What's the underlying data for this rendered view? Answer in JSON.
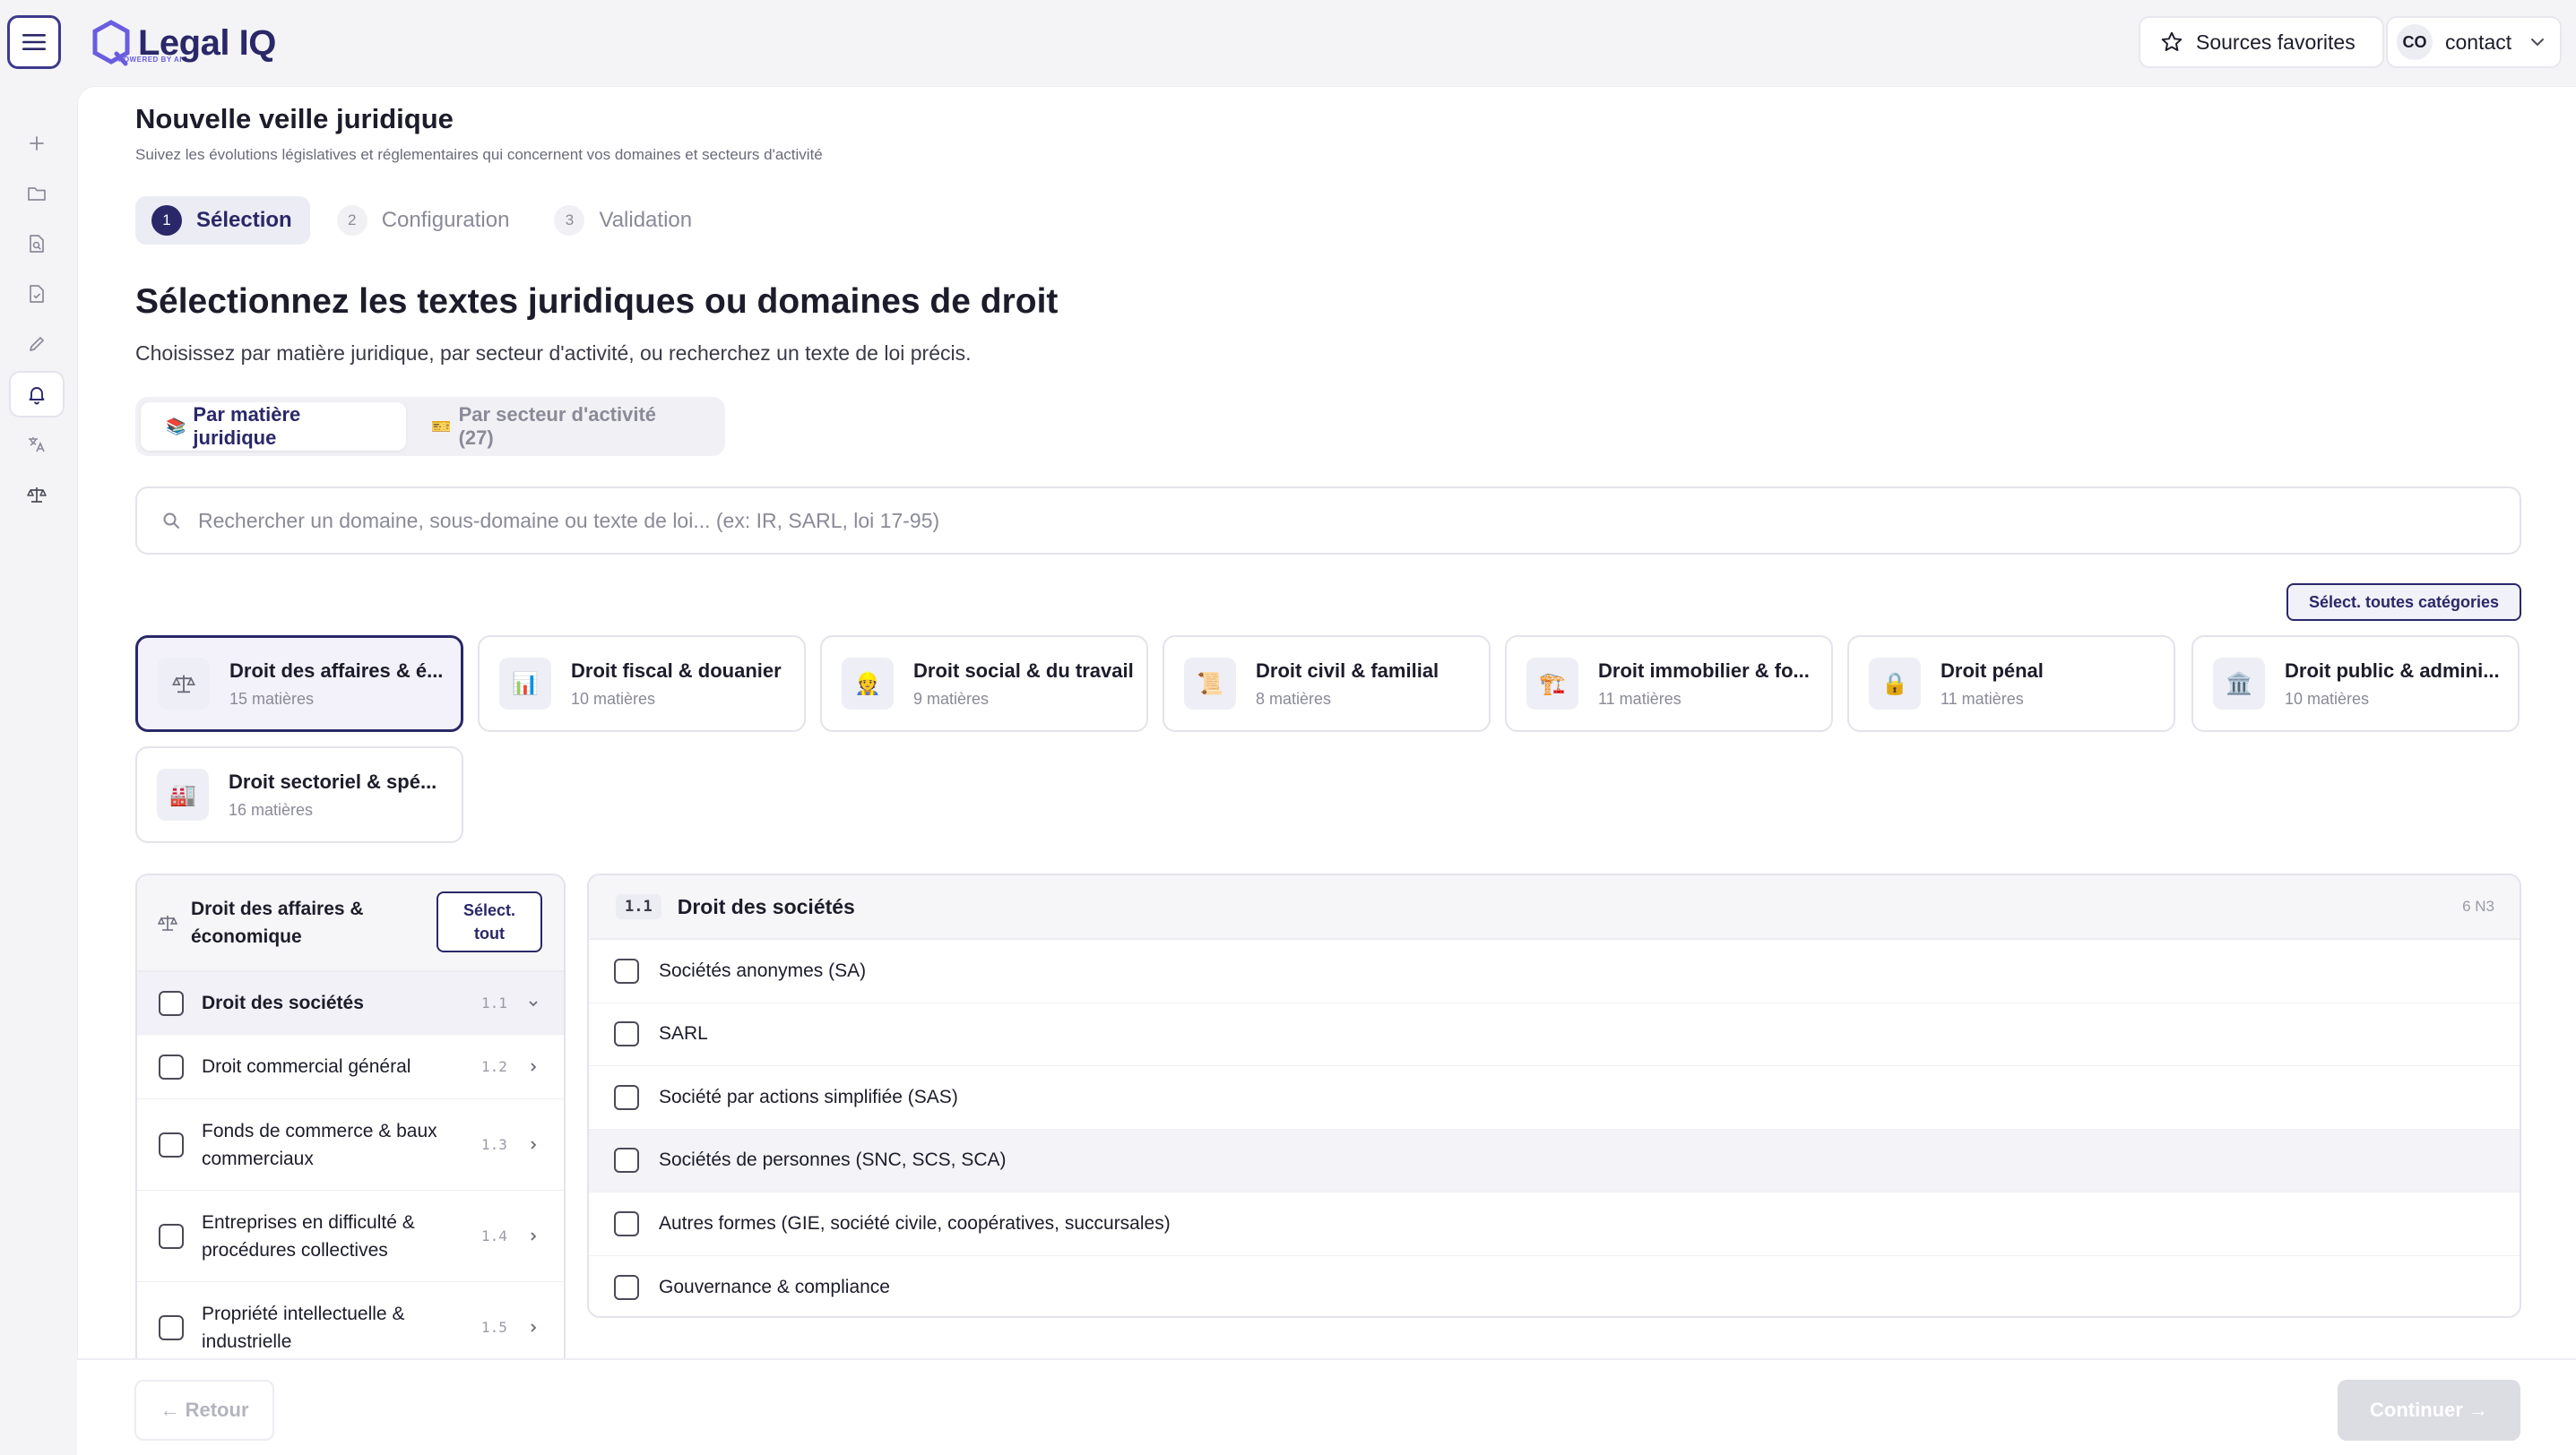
{
  "app": {
    "logo_text": "Legal IQ",
    "logo_sub": "POWERED BY AI",
    "favorites_label": "Sources favorites",
    "user_initials": "CO",
    "user_name": "contact"
  },
  "sidebar": {
    "items": [
      {
        "icon": "plus-icon"
      },
      {
        "icon": "folder-icon"
      },
      {
        "icon": "file-search-icon"
      },
      {
        "icon": "file-check-icon"
      },
      {
        "icon": "pen-icon"
      },
      {
        "icon": "bell-icon",
        "active": true
      },
      {
        "icon": "translate-icon"
      },
      {
        "icon": "scale-icon"
      }
    ]
  },
  "header": {
    "title": "Nouvelle veille juridique",
    "subtitle": "Suivez les évolutions législatives et réglementaires qui concernent vos domaines et secteurs d'activité"
  },
  "steps": [
    {
      "num": "1",
      "label": "Sélection",
      "active": true
    },
    {
      "num": "2",
      "label": "Configuration"
    },
    {
      "num": "3",
      "label": "Validation"
    }
  ],
  "section": {
    "title": "Sélectionnez les textes juridiques ou domaines de droit",
    "subtitle": "Choisissez par matière juridique, par secteur d'activité, ou recherchez un texte de loi précis."
  },
  "tabs": [
    {
      "emoji": "📚",
      "label": "Par matière juridique",
      "active": true
    },
    {
      "emoji": "🎫",
      "label": "Par secteur d'activité (27)"
    }
  ],
  "search": {
    "placeholder": "Rechercher un domaine, sous-domaine ou texte de loi... (ex: IR, SARL, loi 17-95)"
  },
  "select_all_categories": "Sélect. toutes catégories",
  "categories": [
    {
      "name": "Droit des affaires & é...",
      "count": "15 matières",
      "emoji": "⚖️",
      "active": true
    },
    {
      "name": "Droit fiscal & douanier",
      "count": "10 matières",
      "emoji": "📊"
    },
    {
      "name": "Droit social & du travail",
      "count": "9 matières",
      "emoji": "👷"
    },
    {
      "name": "Droit civil & familial",
      "count": "8 matières",
      "emoji": "📜"
    },
    {
      "name": "Droit immobilier & fo...",
      "count": "11 matières",
      "emoji": "🏗️"
    },
    {
      "name": "Droit pénal",
      "count": "11 matières",
      "emoji": "🔒"
    },
    {
      "name": "Droit public & admini...",
      "count": "10 matières",
      "emoji": "🏛️"
    },
    {
      "name": "Droit sectoriel & spé...",
      "count": "16 matières",
      "emoji": "🏭"
    }
  ],
  "left_panel": {
    "title": "Droit des affaires & économique",
    "select_all": "Sélect. tout",
    "items": [
      {
        "label": "Droit des sociétés",
        "code": "1.1",
        "active": true
      },
      {
        "label": "Droit commercial général",
        "code": "1.2"
      },
      {
        "label": "Fonds de commerce & baux commerciaux",
        "code": "1.3"
      },
      {
        "label": "Entreprises en difficulté & procédures collectives",
        "code": "1.4"
      },
      {
        "label": "Propriété intellectuelle & industrielle",
        "code": "1.5"
      }
    ]
  },
  "right_panel": {
    "code": "1.1",
    "title": "Droit des sociétés",
    "count": "6 N3",
    "items": [
      {
        "label": "Sociétés anonymes (SA)"
      },
      {
        "label": "SARL"
      },
      {
        "label": "Société par actions simplifiée (SAS)"
      },
      {
        "label": "Sociétés de personnes (SNC, SCS, SCA)",
        "hover": true
      },
      {
        "label": "Autres formes (GIE, société civile, coopératives, succursales)"
      },
      {
        "label": "Gouvernance & compliance"
      }
    ]
  },
  "footer": {
    "back_label": "← Retour",
    "next_label": "Continuer →"
  },
  "colors": {
    "accent": "#2a2868",
    "accent_light": "#6a5de0",
    "background": "#f4f4f7"
  }
}
